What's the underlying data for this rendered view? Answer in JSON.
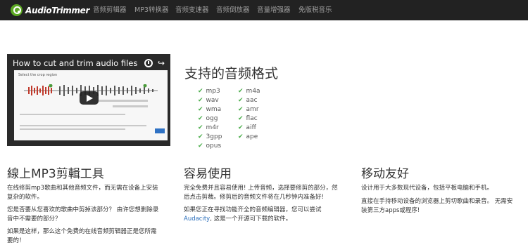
{
  "brand": {
    "name": "AudioTrimmer"
  },
  "nav": {
    "items": [
      {
        "label": "音频剪辑器"
      },
      {
        "label": "MP3转换器"
      },
      {
        "label": "音频变速器"
      },
      {
        "label": "音频倒放器"
      },
      {
        "label": "音量增强器"
      },
      {
        "label": "免版税音乐"
      }
    ]
  },
  "video": {
    "title": "How to cut and trim audio files",
    "caption": "Select the crop region"
  },
  "formats": {
    "title": "支持的音频格式",
    "col1": [
      "mp3",
      "wav",
      "wma",
      "ogg",
      "m4r",
      "3gpp",
      "opus"
    ],
    "col2": [
      "m4a",
      "aac",
      "amr",
      "flac",
      "aiff",
      "ape"
    ]
  },
  "feature1": {
    "title": "線上MP3剪輯工具",
    "p1_line1": "在线修剪mp3歌曲和其他音频文件，而无需在设备上安装",
    "p1_line2": "复杂的软件。",
    "p2_line1": "您是否要从您喜欢的歌曲中剪掉该部分？ 由许您想删除录",
    "p2_line2": "音中不需要的部分？",
    "p3_line1": "如果是这样，那么这个免费的在线音频剪辑器正是您所需",
    "p3_line2": "要的！"
  },
  "feature2": {
    "title": "容易使用",
    "p1_line1": "完全免费并且容易使用! 上传音频，选择要修剪的部分，然",
    "p1_line2": "后点击剪裁。修剪后的音频文件将在几秒钟内准备好!",
    "p2_line1": "如果您正在寻找功能齐全的音频编辑器，您可以尝试",
    "p2_link": "Audacity",
    "p2_rest": ", 这是一个开源可下载的软件。"
  },
  "feature3": {
    "title": "移动友好",
    "p1": "设计用于大多数现代设备，包括平板电脑和手机。",
    "p2_line1": "直接在手持移动设备的浏览器上剪切歌曲和录音。 无需安",
    "p2_line2": "装第三方apps或程序!"
  }
}
